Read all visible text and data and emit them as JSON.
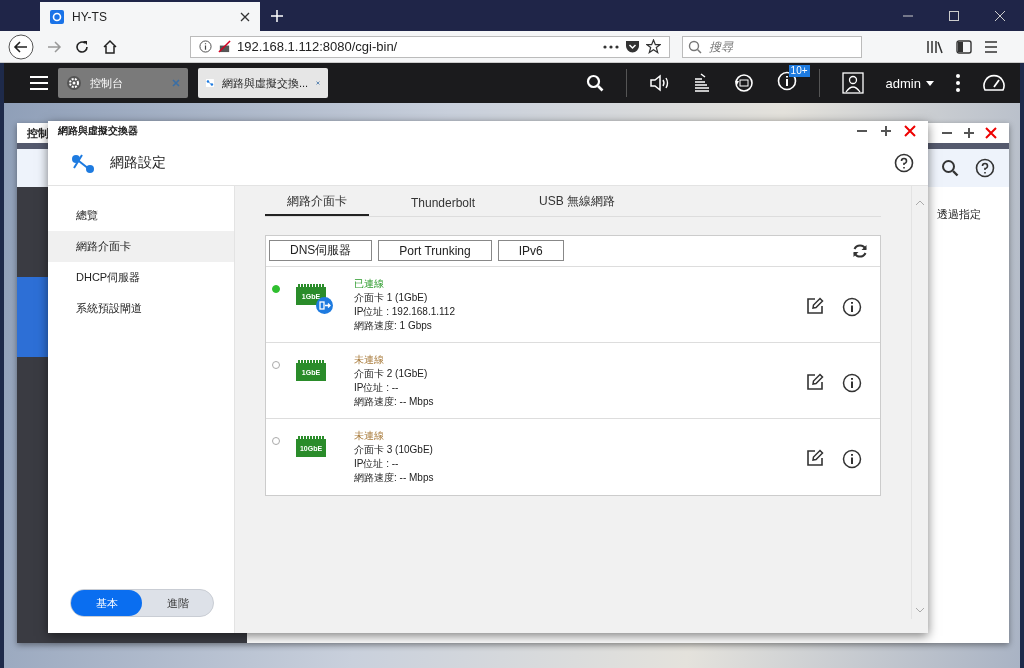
{
  "browser": {
    "tab_title": "HY-TS",
    "url": "192.168.1.112:8080/cgi-bin/",
    "search": {
      "placeholder": "搜尋"
    }
  },
  "taskbar": {
    "apps": [
      {
        "label": "控制台",
        "selected": false
      },
      {
        "label": "網路與虛擬交換...",
        "selected": true
      }
    ],
    "notification_badge": "10+",
    "user": "admin"
  },
  "background_window": {
    "title": "控制",
    "text": "透過指定"
  },
  "window": {
    "title": "網路與虛擬交換器",
    "header": "網路設定",
    "sidebar": {
      "items": [
        {
          "label": "總覽",
          "selected": false
        },
        {
          "label": "網路介面卡",
          "selected": true
        },
        {
          "label": "DHCP伺服器",
          "selected": false
        },
        {
          "label": "系統預設閘道",
          "selected": false
        }
      ]
    },
    "tabs": [
      {
        "label": "網路介面卡",
        "selected": true
      },
      {
        "label": "Thunderbolt",
        "selected": false
      },
      {
        "label": "USB 無線網路",
        "selected": false
      }
    ],
    "buttons": [
      "DNS伺服器",
      "Port Trunking",
      "IPv6"
    ],
    "adapters": [
      {
        "connected": true,
        "status": "已連線",
        "chip_label": "1GbE",
        "default_gateway": true,
        "name": "介面卡 1 (1GbE)",
        "ip": "IP位址 : 192.168.1.112",
        "speed": "網路速度: 1 Gbps"
      },
      {
        "connected": false,
        "status": "未連線",
        "chip_label": "1GbE",
        "default_gateway": false,
        "name": "介面卡 2 (1GbE)",
        "ip": "IP位址 : --",
        "speed": "網路速度: -- Mbps"
      },
      {
        "connected": false,
        "status": "未連線",
        "chip_label": "10GbE",
        "default_gateway": false,
        "name": "介面卡 3 (10GbE)",
        "ip": "IP位址 : --",
        "speed": "網路速度: -- Mbps"
      }
    ],
    "mode_toggle": [
      {
        "label": "基本",
        "selected": true
      },
      {
        "label": "進階",
        "selected": false
      }
    ]
  }
}
